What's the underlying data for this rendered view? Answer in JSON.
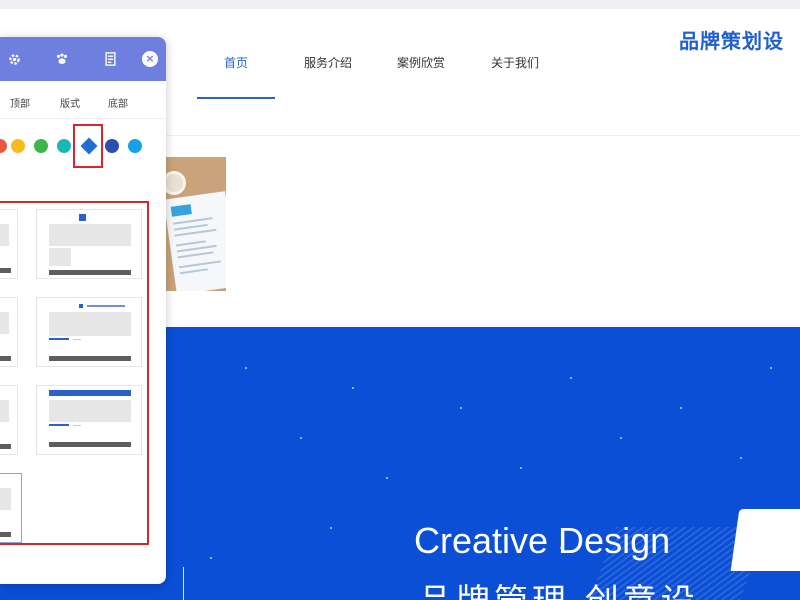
{
  "nav": {
    "items": [
      {
        "label": "首页",
        "active": true
      },
      {
        "label": "服务介绍",
        "active": false
      },
      {
        "label": "案例欣赏",
        "active": false
      },
      {
        "label": "关于我们",
        "active": false
      }
    ]
  },
  "brand": {
    "text": "品牌策划设"
  },
  "panel": {
    "header_icons": [
      "gear-icon",
      "paw-icon",
      "document-icon"
    ],
    "close_label": "×",
    "tabs": [
      "顶部",
      "版式",
      "底部"
    ],
    "swatches": [
      "#e9573f",
      "#f6bb1e",
      "#3fb549",
      "#19b7b3",
      "#1f6ed4",
      "#2a4fb0",
      "#18a1e6"
    ],
    "selected_swatch_index": 4
  },
  "banner": {
    "title": "Creative Design",
    "subtitle": "品牌管理 创意设"
  },
  "colors": {
    "accent": "#2a62c9",
    "banner": "#0b4fd6",
    "panel_header": "#6f7fe0",
    "highlight": "#d9262c"
  }
}
